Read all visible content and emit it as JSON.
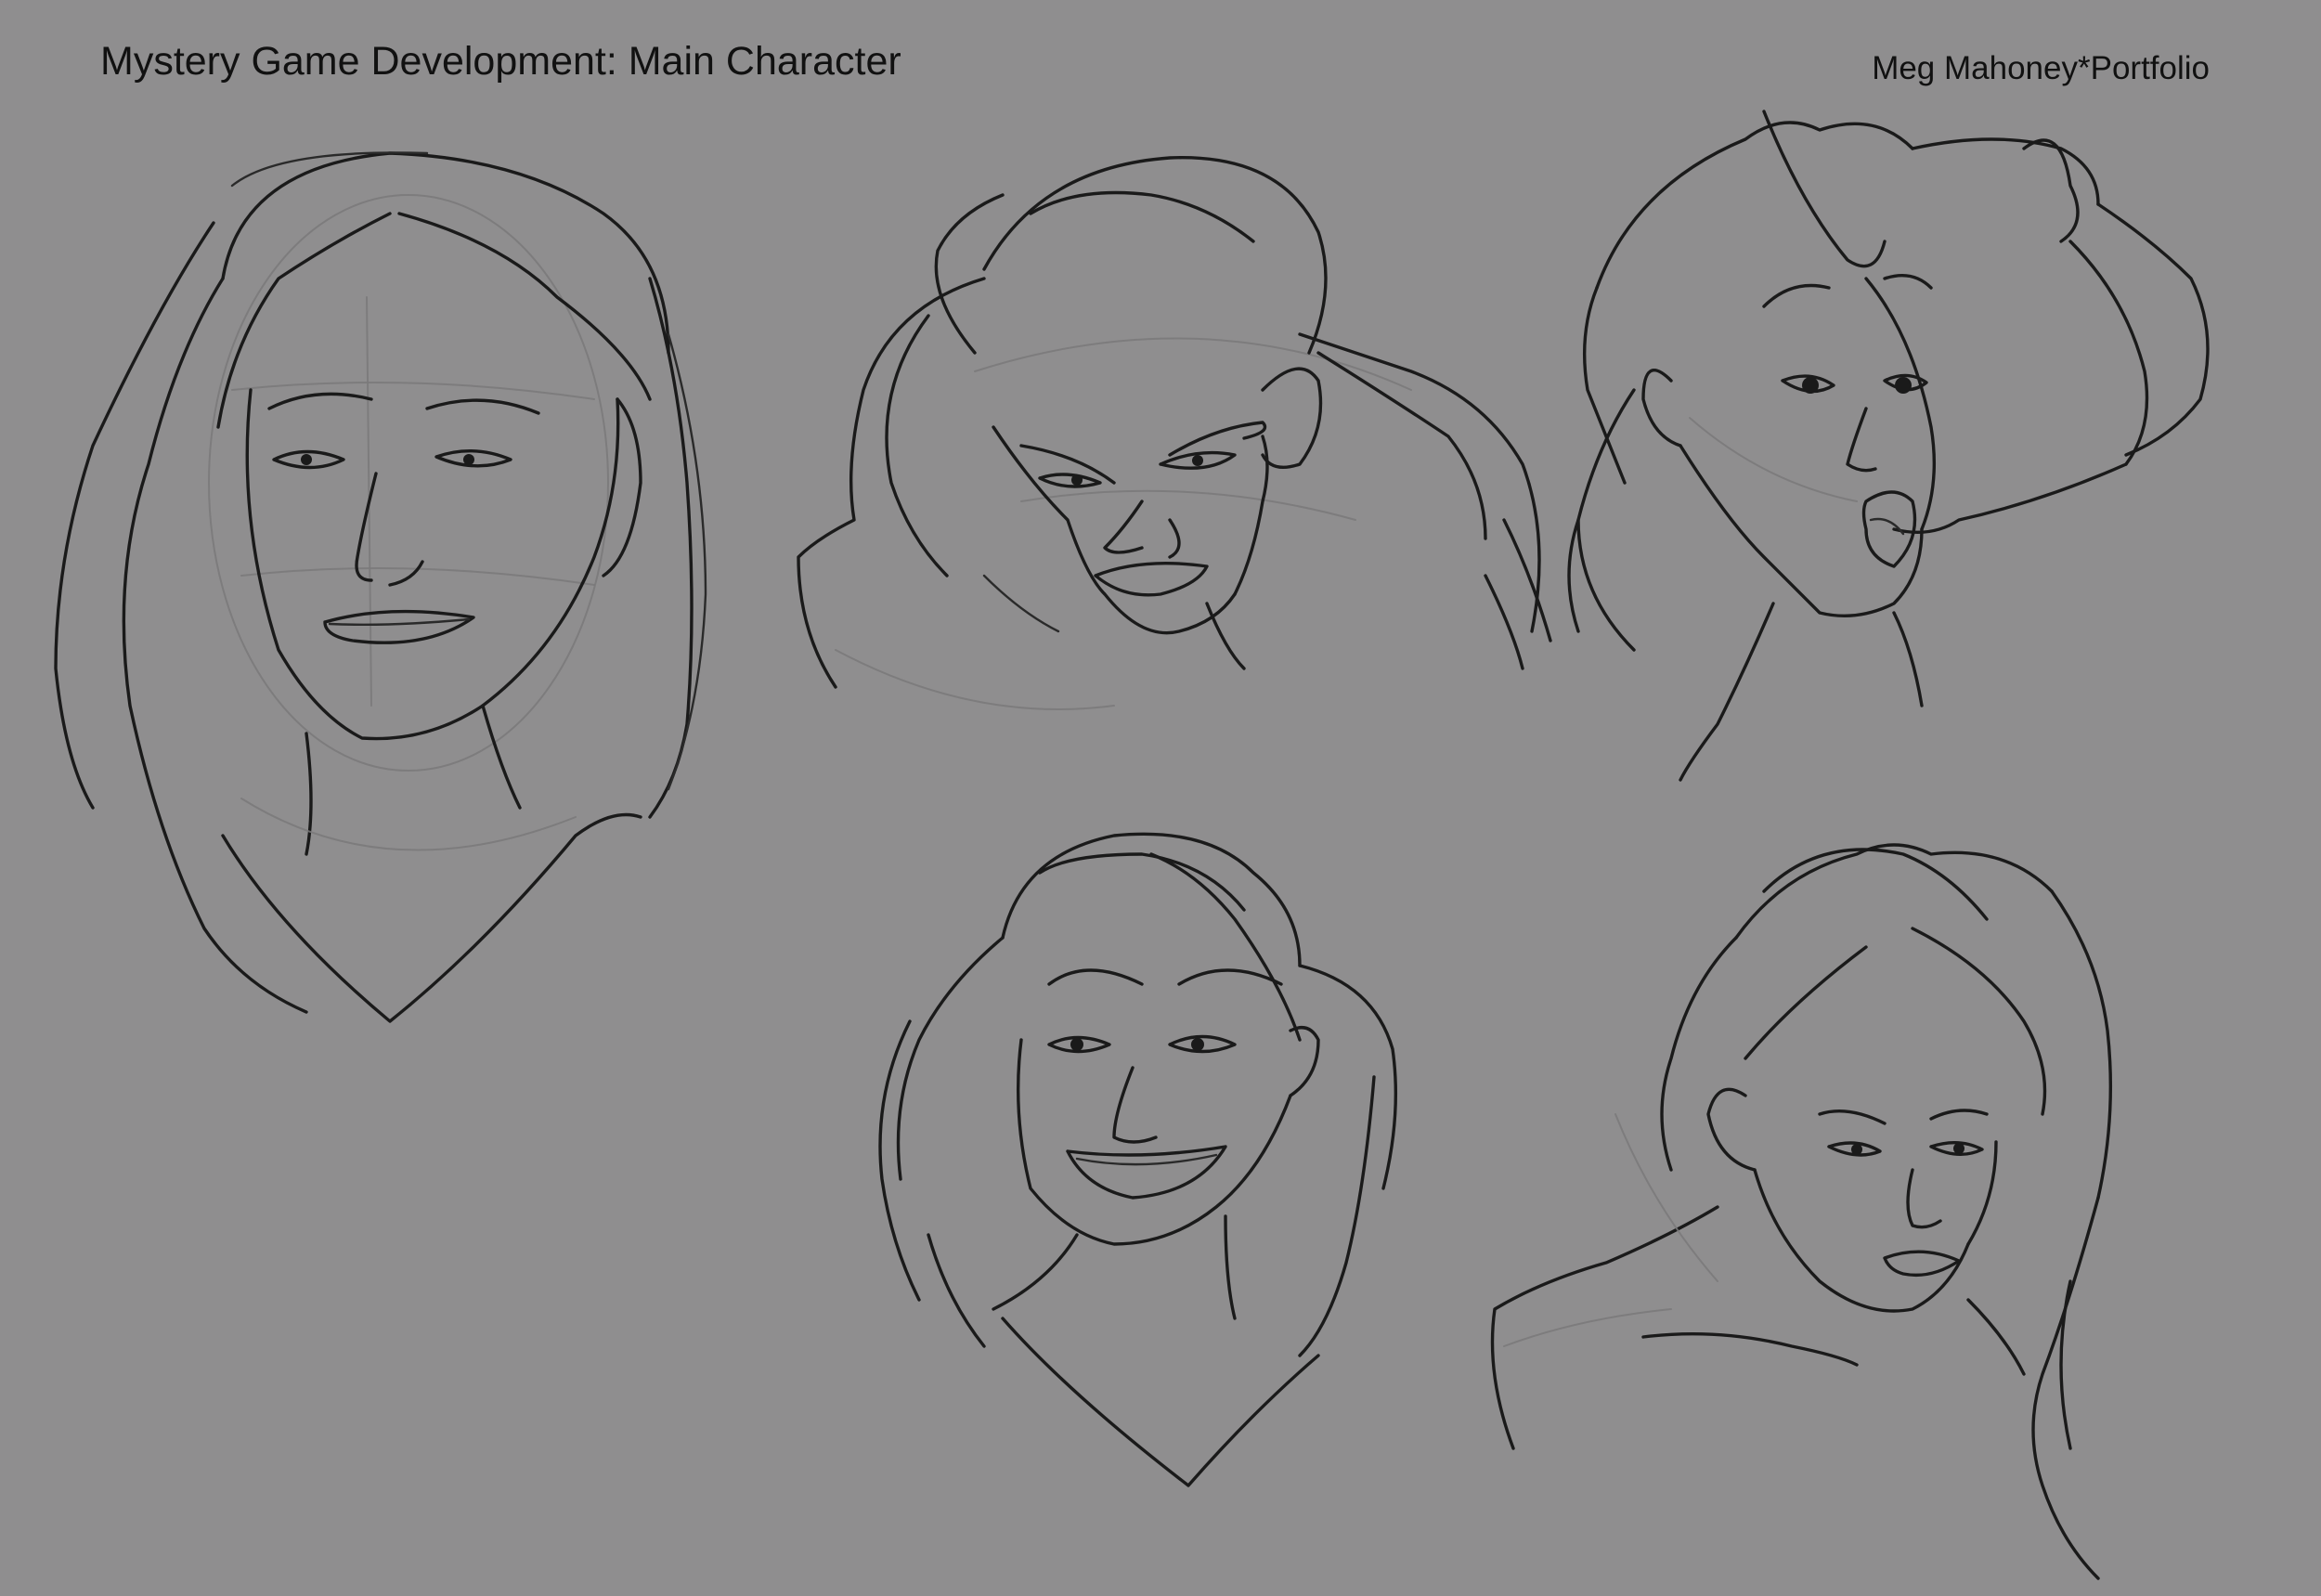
{
  "header": {
    "title": "Mystery Game Development: Main Character",
    "credit": "Meg Mahoney*Portfolio"
  },
  "sketches": [
    {
      "name": "loose-sketch-neutral"
    },
    {
      "name": "expression-angry"
    },
    {
      "name": "expression-surprised"
    },
    {
      "name": "expression-smug-grin"
    },
    {
      "name": "expression-sad"
    }
  ],
  "colors": {
    "background": "#8f8e8f",
    "ink": "#1a1a1a",
    "construction": "#7a797a"
  }
}
